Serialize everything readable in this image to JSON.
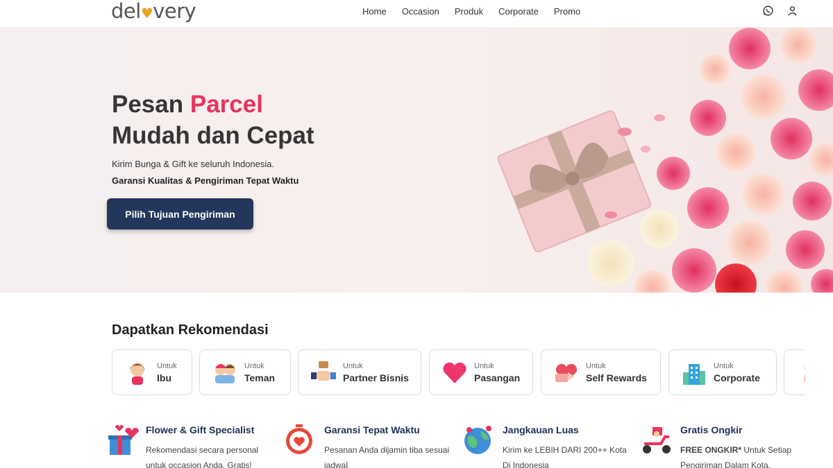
{
  "header": {
    "logo_text": "delovery",
    "nav": [
      "Home",
      "Occasion",
      "Produk",
      "Corporate",
      "Promo"
    ],
    "icons": [
      "whatsapp-icon",
      "user-icon"
    ]
  },
  "hero": {
    "title_prefix": "Pesan",
    "title_accent": "Parcel",
    "title_line2": "Mudah dan Cepat",
    "subtitle": "Kirim Bunga & Gift ke seluruh Indonesia.",
    "subtitle_bold": "Garansi Kualitas & Pengiriman Tepat Waktu",
    "cta_label": "Pilih Tujuan Pengiriman"
  },
  "recommendation": {
    "title": "Dapatkan Rekomendasi",
    "prefix": "Untuk",
    "items": [
      {
        "label": "Ibu",
        "icon": "mother-icon"
      },
      {
        "label": "Teman",
        "icon": "friends-icon"
      },
      {
        "label": "Partner Bisnis",
        "icon": "handshake-icon"
      },
      {
        "label": "Pasangan",
        "icon": "heart-icon"
      },
      {
        "label": "Self Rewards",
        "icon": "gift-heart-icon"
      },
      {
        "label": "Corporate",
        "icon": "building-icon"
      }
    ]
  },
  "features": [
    {
      "title": "Flower & Gift Specialist",
      "desc": "Rekomendasi secara personal untuk occasion Anda. Gratis!",
      "icon": "gift-box-icon"
    },
    {
      "title": "Garansi Tepat Waktu",
      "desc": "Pesanan Anda dijamin tiba sesuai jadwal",
      "icon": "clock-heart-icon"
    },
    {
      "title": "Jangkauan Luas",
      "desc": "Kirim ke LEBIH DARI 200++ Kota Di Indonesia",
      "icon": "globe-icon"
    },
    {
      "title": "Gratis Ongkir",
      "desc_bold": "FREE ONGKIR*",
      "desc": " Untuk Setiap Pengiriman Dalam Kota.",
      "icon": "scooter-icon"
    }
  ],
  "colors": {
    "accent": "#e8335c",
    "navy": "#22375b",
    "logo_heart": "#e8a521"
  }
}
